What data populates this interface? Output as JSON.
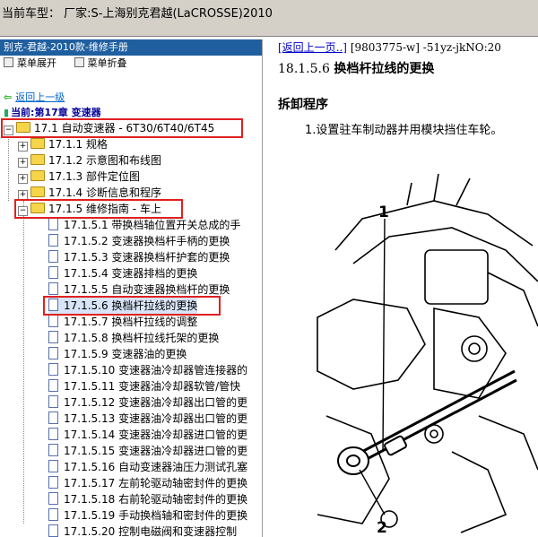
{
  "window": {
    "title": "当前车型：  厂家:S-上海别克君越(LaCROSSE)2010"
  },
  "left": {
    "header": "别克-君越-2010款-维修手册",
    "menu": {
      "expand": "菜单展开",
      "collapse": "菜单折叠"
    },
    "back_link": "返回上一级",
    "current": "当前:第17章  变速器",
    "tree": [
      {
        "label": "17.1 自动变速器 - 6T30/6T40/6T45"
      },
      {
        "label": "17.1.1 规格"
      },
      {
        "label": "17.1.2 示意图和布线图"
      },
      {
        "label": "17.1.3 部件定位图"
      },
      {
        "label": "17.1.4 诊断信息和程序"
      },
      {
        "label": "17.1.5 维修指南 - 车上"
      },
      {
        "label": "17.1.5.1 带换档轴位置开关总成的手"
      },
      {
        "label": "17.1.5.2 变速器换档杆手柄的更换"
      },
      {
        "label": "17.1.5.3 变速器换档杆护套的更换"
      },
      {
        "label": "17.1.5.4 变速器排档的更换"
      },
      {
        "label": "17.1.5.5 自动变速器换档杆的更换"
      },
      {
        "label": "17.1.5.6 换档杆拉线的更换"
      },
      {
        "label": "17.1.5.7 换档杆拉线的调整"
      },
      {
        "label": "17.1.5.8 换档杆拉线托架的更换"
      },
      {
        "label": "17.1.5.9 变速器油的更换"
      },
      {
        "label": "17.1.5.10 变速器油冷却器管连接器的"
      },
      {
        "label": "17.1.5.11 变速器油冷却器软管/管快"
      },
      {
        "label": "17.1.5.12 变速器油冷却器出口管的更"
      },
      {
        "label": "17.1.5.13 变速器油冷却器出口管的更"
      },
      {
        "label": "17.1.5.14 变速器油冷却器进口管的更"
      },
      {
        "label": "17.1.5.15 变速器油冷却器进口管的更"
      },
      {
        "label": "17.1.5.16 自动变速器油压力测试孔塞"
      },
      {
        "label": "17.1.5.17 左前轮驱动轴密封件的更换"
      },
      {
        "label": "17.1.5.18 右前轮驱动轴密封件的更换"
      },
      {
        "label": "17.1.5.19 手动换档轴和密封件的更换"
      },
      {
        "label": "17.1.5.20 控制电磁阀和变速器控制"
      }
    ]
  },
  "right": {
    "back_link": "[返回上一页..]",
    "ref": "[9803775-w] -51yz-jkNO:20",
    "title_num": "18.1.5.6 ",
    "title_text": "换档杆拉线的更换",
    "section": "拆卸程序",
    "step": "1.设置驻车制动器并用模块挡住车轮。",
    "callouts": {
      "one": "1",
      "two": "2"
    }
  }
}
